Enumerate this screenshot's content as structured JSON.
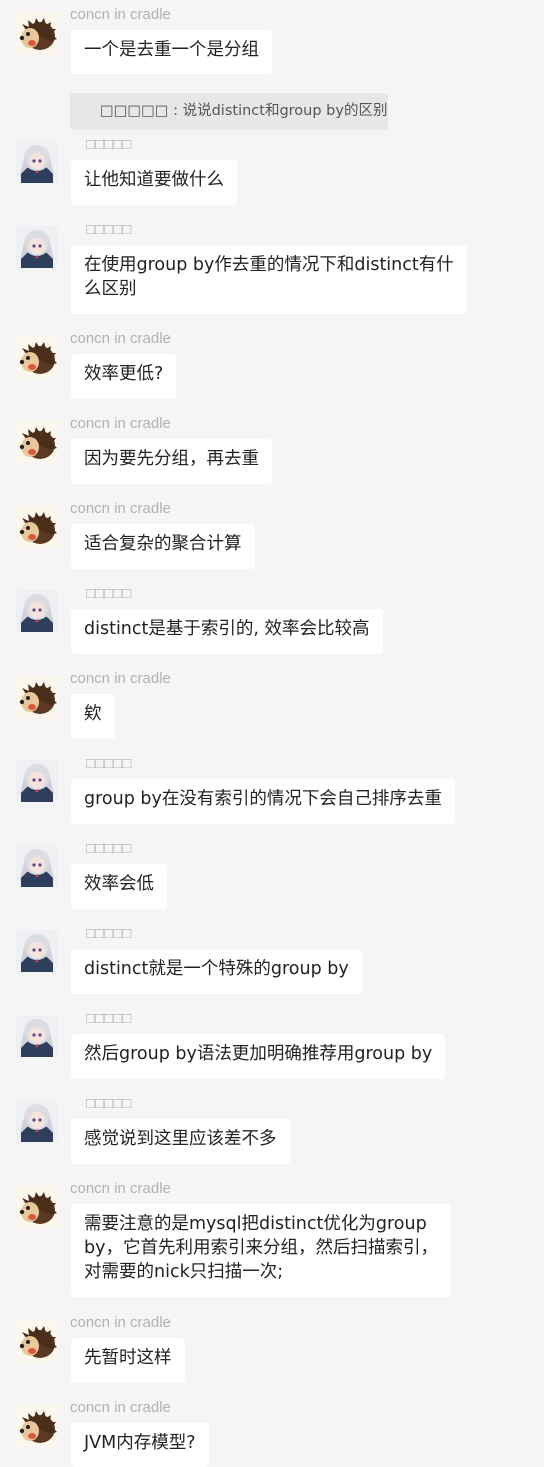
{
  "users": {
    "hedgehog": "concn in cradle",
    "girl": "□□□□□"
  },
  "quote": "□□□□□ : 说说distinct和group by的区别",
  "messages": [
    {
      "sender": "hedgehog",
      "text": "一个是去重一个是分组"
    },
    {
      "sender": "girl",
      "text": "让他知道要做什么"
    },
    {
      "sender": "girl",
      "text": "在使用group by作去重的情况下和distinct有什\n么区别"
    },
    {
      "sender": "hedgehog",
      "text": "效率更低?"
    },
    {
      "sender": "hedgehog",
      "text": "因为要先分组，再去重"
    },
    {
      "sender": "hedgehog",
      "text": "适合复杂的聚合计算"
    },
    {
      "sender": "girl",
      "text": "distinct是基于索引的, 效率会比较高"
    },
    {
      "sender": "hedgehog",
      "text": "欸"
    },
    {
      "sender": "girl",
      "text": "group by在没有索引的情况下会自己排序去重"
    },
    {
      "sender": "girl",
      "text": "效率会低"
    },
    {
      "sender": "girl",
      "text": "distinct就是一个特殊的group by"
    },
    {
      "sender": "girl",
      "text": "然后group by语法更加明确推荐用group by"
    },
    {
      "sender": "girl",
      "text": "感觉说到这里应该差不多"
    },
    {
      "sender": "hedgehog",
      "text": "需要注意的是mysql把distinct优化为group\nby，它首先利用索引来分组，然后扫描索引，\n对需要的nick只扫描一次;"
    },
    {
      "sender": "hedgehog",
      "text": "先暂时这样"
    },
    {
      "sender": "hedgehog",
      "text": "JVM内存模型?"
    }
  ]
}
